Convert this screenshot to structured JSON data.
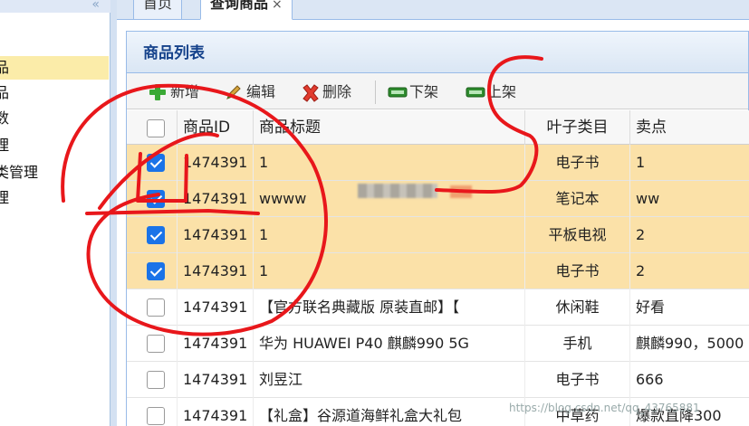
{
  "sidebar": {
    "items": [
      {
        "label": "品",
        "selected": true
      },
      {
        "label": "品",
        "selected": false
      },
      {
        "label": "数",
        "selected": false
      },
      {
        "label": "理",
        "selected": false
      },
      {
        "label": "类管理",
        "selected": false
      },
      {
        "label": "理",
        "selected": false
      }
    ],
    "collapse_icon": "double-chevron-left-icon"
  },
  "tabs": [
    {
      "label": "首页",
      "active": false
    },
    {
      "label": "查询商品",
      "active": true,
      "close": "×"
    }
  ],
  "panel": {
    "title": "商品列表"
  },
  "toolbar": {
    "add_label": "新增",
    "edit_label": "编辑",
    "delete_label": "删除",
    "offshelf_label": "下架",
    "onshelf_label": "上架"
  },
  "grid": {
    "columns": [
      "商品ID",
      "商品标题",
      "叶子类目",
      "卖点"
    ],
    "rows": [
      {
        "id": "1474391",
        "title": "1",
        "category": "电子书",
        "point": "1",
        "checked": true
      },
      {
        "id": "1474391",
        "title": "wwww",
        "category": "笔记本",
        "point": "ww",
        "checked": true
      },
      {
        "id": "1474391",
        "title": "1",
        "category": "平板电视",
        "point": "2",
        "checked": true
      },
      {
        "id": "1474391",
        "title": "1",
        "category": "电子书",
        "point": "2",
        "checked": true
      },
      {
        "id": "1474391",
        "title": "【官方联名典藏版 原装直邮】【",
        "category": "休闲鞋",
        "point": "好看",
        "checked": false
      },
      {
        "id": "1474391",
        "title": "华为 HUAWEI P40 麒麟990 5G",
        "category": "手机",
        "point": "麒麟990，5000",
        "checked": false
      },
      {
        "id": "1474391",
        "title": "刘昱江",
        "category": "电子书",
        "point": "666",
        "checked": false
      },
      {
        "id": "1474391",
        "title": "【礼盒】谷源道海鲜礼盒大礼包",
        "category": "中草药",
        "point": "爆款直降300",
        "checked": false
      }
    ]
  },
  "watermark": "https://blog.csdn.net/qq_43765881",
  "colors": {
    "selected_row": "#fbe1a8",
    "checkbox": "#1a73e8",
    "header_text": "#15428b",
    "annotation_ink": "#e8171b"
  }
}
